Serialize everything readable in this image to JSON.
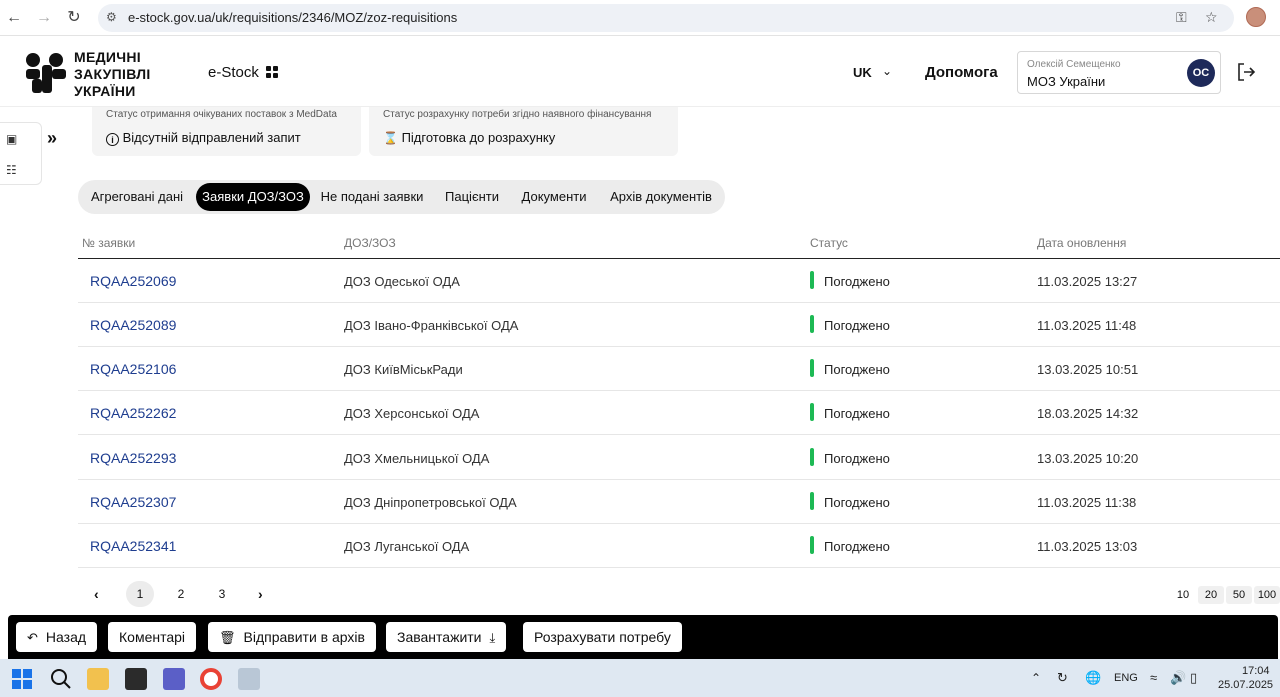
{
  "browser": {
    "url": "e-stock.gov.ua/uk/requisitions/2346/MOZ/zoz-requisitions"
  },
  "header": {
    "logo_lines": [
      "МЕДИЧНІ",
      "ЗАКУПІВЛІ",
      "УКРАЇНИ"
    ],
    "app_name": "e-Stock",
    "language": "UK",
    "help_label": "Допомога",
    "user": {
      "name": "Олексій Семещенко",
      "organization": "МОЗ України",
      "initials": "ОС"
    }
  },
  "status_cards": [
    {
      "label": "Статус отримання очікуваних поставок з MedData",
      "icon": "info-icon",
      "value": "Відсутній відправлений запит"
    },
    {
      "label": "Статус розрахунку потреби згідно наявного фінансування",
      "icon": "hourglass-icon",
      "value": "Підготовка до розрахунку"
    }
  ],
  "tabs": [
    {
      "label": "Агреговані дані",
      "active": false
    },
    {
      "label": "Заявки ДОЗ/ЗОЗ",
      "active": true
    },
    {
      "label": "Не подані заявки",
      "active": false
    },
    {
      "label": "Пацієнти",
      "active": false
    },
    {
      "label": "Документи",
      "active": false
    },
    {
      "label": "Архів документів",
      "active": false
    }
  ],
  "table": {
    "columns": [
      "№ заявки",
      "ДОЗ/ЗОЗ",
      "Статус",
      "Дата оновлення"
    ],
    "rows": [
      {
        "number": "RQAA252069",
        "org": "ДОЗ Одеської ОДА",
        "status": "Погоджено",
        "date": "11.03.2025 13:27"
      },
      {
        "number": "RQAA252089",
        "org": "ДОЗ Івано-Франківської ОДА",
        "status": "Погоджено",
        "date": "11.03.2025 11:48"
      },
      {
        "number": "RQAA252106",
        "org": "ДОЗ КиївМіськРади",
        "status": "Погоджено",
        "date": "13.03.2025 10:51"
      },
      {
        "number": "RQAA252262",
        "org": "ДОЗ Херсонської ОДА",
        "status": "Погоджено",
        "date": "18.03.2025 14:32"
      },
      {
        "number": "RQAA252293",
        "org": "ДОЗ Хмельницької ОДА",
        "status": "Погоджено",
        "date": "13.03.2025 10:20"
      },
      {
        "number": "RQAA252307",
        "org": "ДОЗ Дніпропетровської ОДА",
        "status": "Погоджено",
        "date": "11.03.2025 11:38"
      },
      {
        "number": "RQAA252341",
        "org": "ДОЗ Луганської ОДА",
        "status": "Погоджено",
        "date": "11.03.2025 13:03"
      }
    ],
    "status_color": "#1db954"
  },
  "pagination": {
    "pages": [
      "1",
      "2",
      "3"
    ],
    "current": "1",
    "page_sizes": [
      "10",
      "20",
      "50",
      "100"
    ]
  },
  "actions": [
    {
      "label": "Назад",
      "icon": "back-arrow-icon"
    },
    {
      "label": "Коментарі",
      "icon": ""
    },
    {
      "label": "Відправити в архів",
      "icon": "trash-icon"
    },
    {
      "label": "Завантажити",
      "icon": "download-icon"
    },
    {
      "label": "Розрахувати потребу",
      "icon": ""
    }
  ],
  "taskbar": {
    "language": "ENG",
    "time": "17:04",
    "date": "25.07.2025"
  },
  "colors": {
    "link": "#1e3d8f",
    "active_tab": "#000000",
    "avatar_bg": "#1e2a5a",
    "action_bar": "#000000"
  }
}
